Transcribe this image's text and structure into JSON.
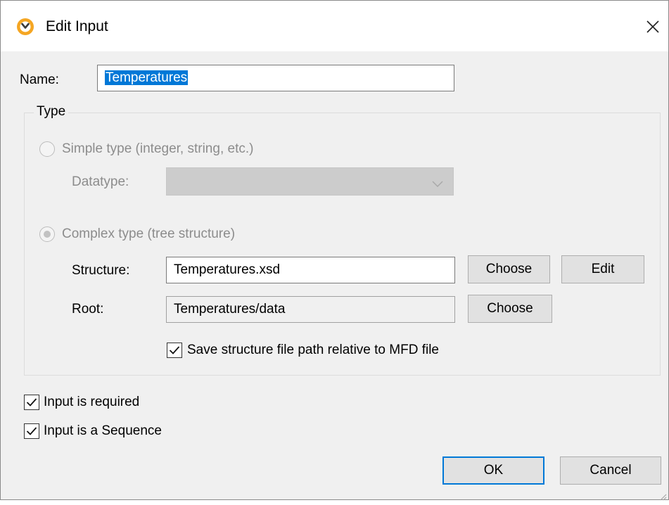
{
  "window": {
    "title": "Edit Input",
    "app_icon": "altova-mapforce-icon",
    "close_icon": "close-icon"
  },
  "name_field": {
    "label": "Name:",
    "value": "Temperatures"
  },
  "type_group": {
    "title": "Type",
    "simple_type": {
      "label": "Simple type (integer, string, etc.)",
      "selected": false,
      "enabled": false
    },
    "datatype": {
      "label": "Datatype:",
      "value": "",
      "enabled": false
    },
    "complex_type": {
      "label": "Complex type (tree structure)",
      "selected": true,
      "enabled": false
    },
    "structure": {
      "label": "Structure:",
      "value": "Temperatures.xsd",
      "choose_label": "Choose",
      "edit_label": "Edit"
    },
    "root": {
      "label": "Root:",
      "value": "Temperatures/data",
      "choose_label": "Choose"
    },
    "save_relative": {
      "label": "Save structure file path relative to MFD file",
      "checked": true
    }
  },
  "input_required": {
    "label": "Input is required",
    "checked": true
  },
  "input_sequence": {
    "label": "Input is a Sequence",
    "checked": true
  },
  "footer": {
    "ok_label": "OK",
    "cancel_label": "Cancel"
  },
  "colors": {
    "accent": "#0078d7",
    "dialog_bg": "#f0f0f0",
    "disabled_text": "#8c8c8c",
    "icon_orange": "#f5a623"
  }
}
